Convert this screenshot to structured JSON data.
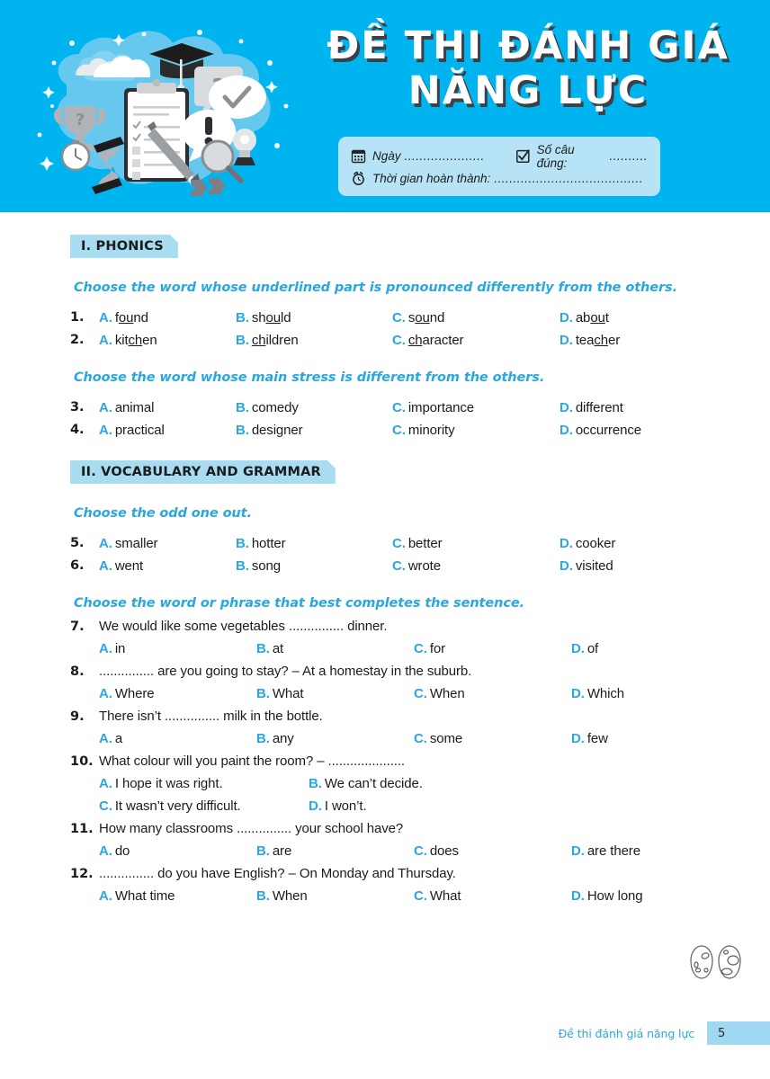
{
  "banner": {
    "title_line1": "ĐỀ THI ĐÁNH GIÁ",
    "title_line2": "NĂNG LỰC",
    "background_color": "#00b5ef",
    "info": {
      "date_label": "Ngày",
      "date_dots": ".....................",
      "correct_label": "Số câu đúng:",
      "correct_dots": "..........",
      "time_label": "Thời gian hoàn thành:",
      "time_dots": "......................................."
    }
  },
  "sections": [
    {
      "tag": "I. PHONICS"
    },
    {
      "tag": "II. VOCABULARY AND GRAMMAR"
    }
  ],
  "instructions": {
    "phonics_underline": "Choose the word whose underlined part is pronounced differently from the others.",
    "phonics_stress": "Choose the word whose main stress is different from the others.",
    "odd_one_out": "Choose the odd one out.",
    "best_completes": "Choose the word or phrase that best completes the sentence."
  },
  "questions": {
    "q1": {
      "num": "1.",
      "a": {
        "letter": "A.",
        "pre": "f",
        "mid": "ou",
        "post": "nd"
      },
      "b": {
        "letter": "B.",
        "pre": "sh",
        "mid": "ou",
        "post": "ld"
      },
      "c": {
        "letter": "C.",
        "pre": "s",
        "mid": "ou",
        "post": "nd"
      },
      "d": {
        "letter": "D.",
        "pre": "ab",
        "mid": "ou",
        "post": "t"
      }
    },
    "q2": {
      "num": "2.",
      "a": {
        "letter": "A.",
        "pre": "kit",
        "mid": "ch",
        "post": "en"
      },
      "b": {
        "letter": "B.",
        "pre": "",
        "mid": "ch",
        "post": "ildren"
      },
      "c": {
        "letter": "C.",
        "pre": "",
        "mid": "ch",
        "post": "aracter"
      },
      "d": {
        "letter": "D.",
        "pre": "tea",
        "mid": "ch",
        "post": "er"
      }
    },
    "q3": {
      "num": "3.",
      "a": "animal",
      "b": "comedy",
      "c": "importance",
      "d": "different"
    },
    "q4": {
      "num": "4.",
      "a": "practical",
      "b": "designer",
      "c": "minority",
      "d": "occurrence"
    },
    "q5": {
      "num": "5.",
      "a": "smaller",
      "b": "hotter",
      "c": "better",
      "d": "cooker"
    },
    "q6": {
      "num": "6.",
      "a": "went",
      "b": "song",
      "c": "wrote",
      "d": "visited"
    },
    "q7": {
      "num": "7.",
      "stem": "We would like some vegetables ............... dinner.",
      "a": "in",
      "b": "at",
      "c": "for",
      "d": "of"
    },
    "q8": {
      "num": "8.",
      "stem": "............... are you going to stay? – At a homestay in the suburb.",
      "a": "Where",
      "b": "What",
      "c": "When",
      "d": "Which"
    },
    "q9": {
      "num": "9.",
      "stem": "There isn’t ............... milk in the bottle.",
      "a": "a",
      "b": "any",
      "c": "some",
      "d": "few"
    },
    "q10": {
      "num": "10.",
      "stem": "What colour will you paint the room? – .....................",
      "a": "I hope it was right.",
      "b": "We can’t decide.",
      "c": "It wasn’t very difficult.",
      "d": "I won’t."
    },
    "q11": {
      "num": "11.",
      "stem": "How many classrooms ............... your school have?",
      "a": "do",
      "b": "are",
      "c": "does",
      "d": "are there"
    },
    "q12": {
      "num": "12.",
      "stem": "............... do you have English? – On Monday and Thursday.",
      "a": "What time",
      "b": "When",
      "c": "What",
      "d": "How long"
    }
  },
  "letters": {
    "a": "A.",
    "b": "B.",
    "c": "C.",
    "d": "D."
  },
  "footer": {
    "text": "Đề thi đánh giá năng lực",
    "page": "5",
    "badge_color": "#9ed8f2"
  },
  "icons": {
    "calendar": "calendar-icon",
    "checkbox": "checkbox-icon",
    "alarm": "alarm-clock-icon"
  }
}
